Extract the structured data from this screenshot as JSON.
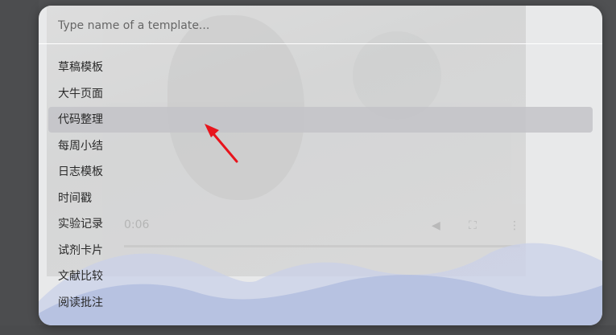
{
  "search": {
    "placeholder": "Type name of a template..."
  },
  "templates": [
    {
      "label": "草稿模板",
      "selected": false
    },
    {
      "label": "大牛页面",
      "selected": false
    },
    {
      "label": "代码整理",
      "selected": true
    },
    {
      "label": "每周小结",
      "selected": false
    },
    {
      "label": "日志模板",
      "selected": false
    },
    {
      "label": "时间戳",
      "selected": false
    },
    {
      "label": "实验记录",
      "selected": false
    },
    {
      "label": "试剂卡片",
      "selected": false
    },
    {
      "label": "文献比较",
      "selected": false
    },
    {
      "label": "阅读批注",
      "selected": false
    }
  ],
  "background_video": {
    "time": "0:06"
  },
  "colors": {
    "accent_arrow": "#e8141c",
    "wave": "#b3bedf",
    "selection": "#c3c3c8"
  }
}
